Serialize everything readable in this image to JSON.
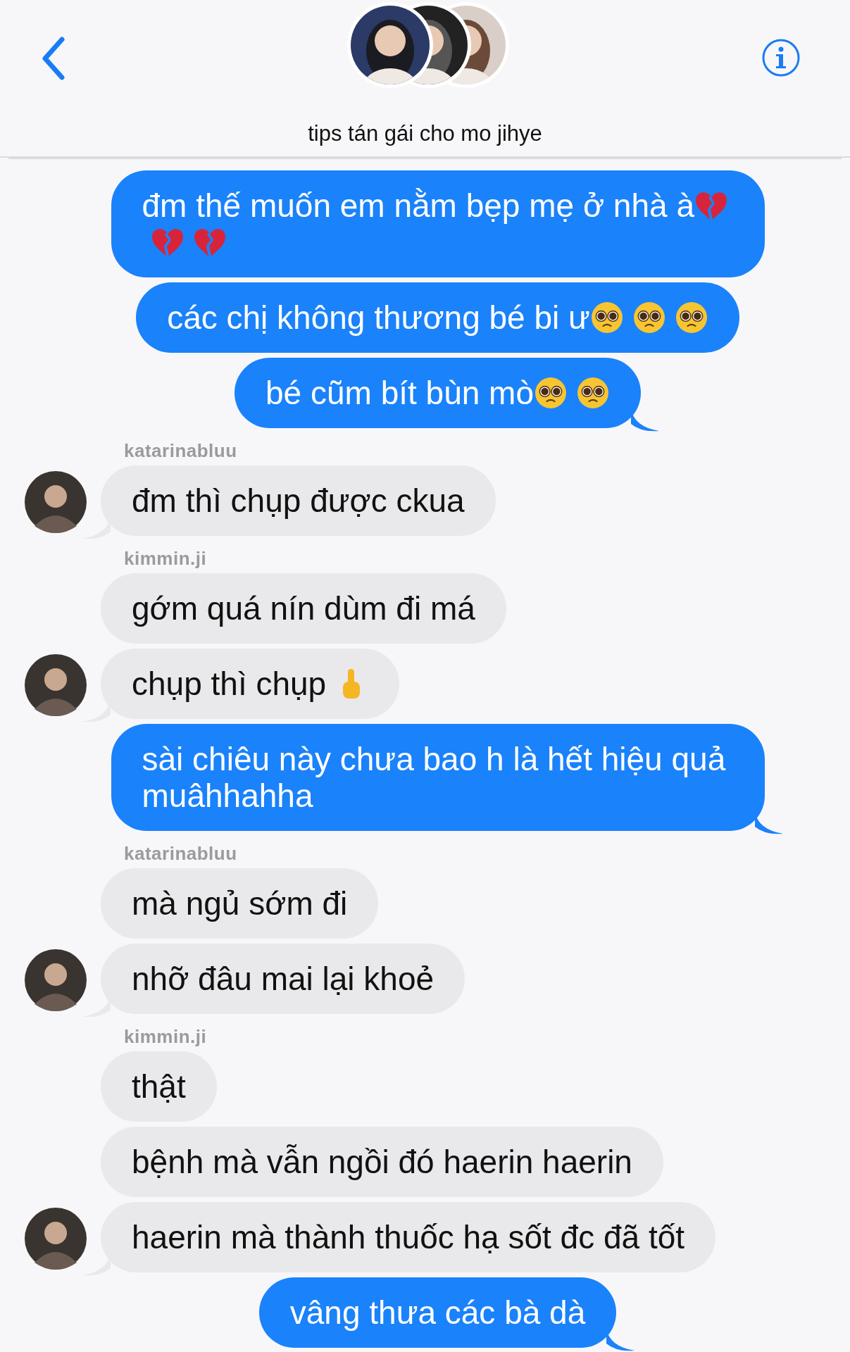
{
  "header": {
    "title": "tips tán gái cho mo jihye"
  },
  "messages": [
    {
      "kind": "sent",
      "text": "đm thế muốn em nằm bẹp mẹ ở nhà à",
      "emoji": [
        {
          "kind": "broken-heart"
        },
        {
          "kind": "broken-heart"
        },
        {
          "kind": "broken-heart"
        }
      ],
      "tail": false
    },
    {
      "kind": "sent",
      "text": "các chị không thương bé bi ư",
      "emoji": [
        {
          "kind": "pleading-face"
        },
        {
          "kind": "pleading-face"
        },
        {
          "kind": "pleading-face"
        }
      ],
      "tail": false
    },
    {
      "kind": "sent",
      "text": "bé cũm bít bùn mò",
      "emoji": [
        {
          "kind": "pleading-face"
        },
        {
          "kind": "pleading-face"
        }
      ],
      "tail": true
    },
    {
      "kind": "sender-name",
      "text": "katarinabluu"
    },
    {
      "kind": "received",
      "text": "đm thì chụp được ckua",
      "tail": true
    },
    {
      "kind": "sender-name",
      "text": "kimmin.ji"
    },
    {
      "kind": "received",
      "text": "gớm quá nín dùm đi má",
      "tail": false
    },
    {
      "kind": "received",
      "text": "chụp thì chụp",
      "emoji": [
        {
          "kind": "raised-finger"
        }
      ],
      "tail": true
    },
    {
      "kind": "sent",
      "text": "sài chiêu này chưa bao h là hết hiệu quả muâhhahha",
      "tail": true
    },
    {
      "kind": "sender-name",
      "text": "katarinabluu"
    },
    {
      "kind": "received",
      "text": "mà ngủ sớm đi",
      "tail": false
    },
    {
      "kind": "received",
      "text": "nhỡ đâu mai lại khoẻ",
      "tail": true
    },
    {
      "kind": "sender-name",
      "text": "kimmin.ji"
    },
    {
      "kind": "received",
      "text": "thật",
      "tail": false
    },
    {
      "kind": "received",
      "text": "bệnh mà vẫn ngồi đó haerin haerin",
      "tail": false
    },
    {
      "kind": "received",
      "text": "haerin mà thành thuốc hạ sốt đc đã tốt",
      "tail": true
    },
    {
      "kind": "sent",
      "text": "vâng thưa các bà dà",
      "tail": true
    }
  ]
}
